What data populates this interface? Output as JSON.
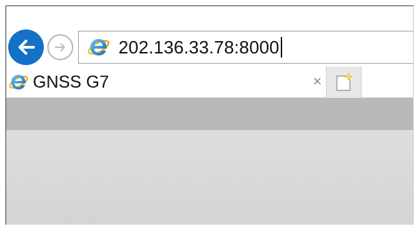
{
  "nav": {
    "back_icon": "back-arrow-icon",
    "forward_icon": "forward-arrow-icon"
  },
  "address_bar": {
    "icon": "ie-logo-icon",
    "url": "202.136.33.78:8000"
  },
  "tabs": [
    {
      "icon": "ie-logo-icon",
      "label": "GNSS G7",
      "close_label": "×"
    }
  ],
  "new_tab": {
    "icon": "new-tab-icon"
  },
  "colors": {
    "back_button": "#1570c8",
    "toolbar_strip": "#b9b9b9",
    "content_bg": "#dadada"
  }
}
